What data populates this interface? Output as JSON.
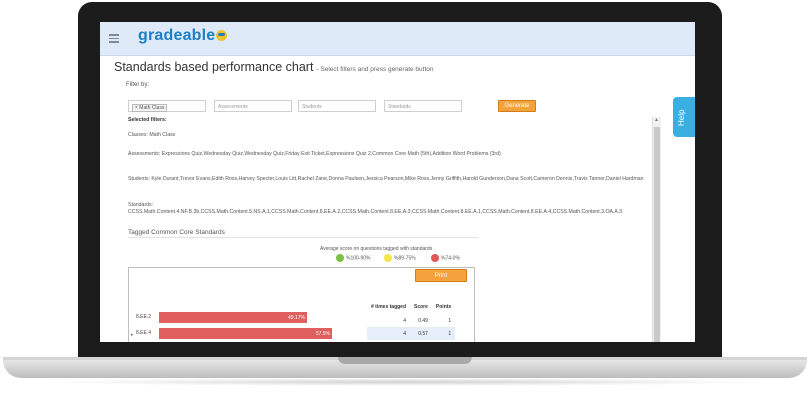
{
  "app": {
    "brand": "gradeable",
    "page_title": "Standards based performance chart",
    "page_subtitle": "- Select filters and press generate button",
    "filter_by_label": "Filter by:",
    "help_label": "Help"
  },
  "filters": {
    "classes_chip": "× Math Class",
    "assessments_placeholder": "Assessments",
    "students_placeholder": "Students",
    "standards_placeholder": "Standards",
    "generate_label": "Generate"
  },
  "selected": {
    "heading": "Selected filters:",
    "classes": "Classes: Math Class",
    "assessments": "Assessments: Expressions Quiz,Wednesday Quiz,Wednesday Quiz,Friday Exit Ticket,Expressions Quiz 2,Common Core Math (5th),Addition Word Problems (3rd)",
    "students": "Students: Kyle Durant,Trevor Evans,Edith Ross,Harvey Specter,Louis Litt,Rachel Zane,Donna Paulsen,Jessica Pearson,Mike Ross,Jenny Griffith,Harold Gunderson,Dana Scott,Cameron Dennis,Travis Tanner,Daniel Hardman",
    "standards_label": "Standards:",
    "standards": "CCSS.Math.Content.4.NF.B.3b,CCSS.Math.Content.5.NS.A.1,CCSS.Math.Content.8.EE.A.2,CCSS.Math.Content.8.EE.A.3,CCSS.Math.Content.8.EE.A.1,CCSS.Math.Content.8.EE.A.4,CCSS.Math.Content.3.OA.A.3"
  },
  "tagged_section": {
    "heading": "Tagged Common Core Standards",
    "legend_title": "Average score on questions tagged with standards",
    "legend": [
      {
        "label": "%100-90%",
        "color": "#7ac143"
      },
      {
        "label": "%89-75%",
        "color": "#f3e54a"
      },
      {
        "label": "%74-0%",
        "color": "#e05757"
      }
    ],
    "print_label": "Print"
  },
  "chart_data": {
    "type": "bar",
    "orientation": "horizontal",
    "categories": [
      "8.EE.2",
      "8.EE.4"
    ],
    "values": [
      49.17,
      57.5
    ],
    "value_labels": [
      "49.17%",
      "57.5%"
    ],
    "xlim": [
      0,
      100
    ],
    "bar_color": "#e06060"
  },
  "stats_table": {
    "headers": [
      "# times tagged",
      "Score",
      "Points"
    ],
    "rows": [
      [
        "4",
        "0.49",
        "1"
      ],
      [
        "4",
        "0.57",
        "1"
      ]
    ]
  }
}
